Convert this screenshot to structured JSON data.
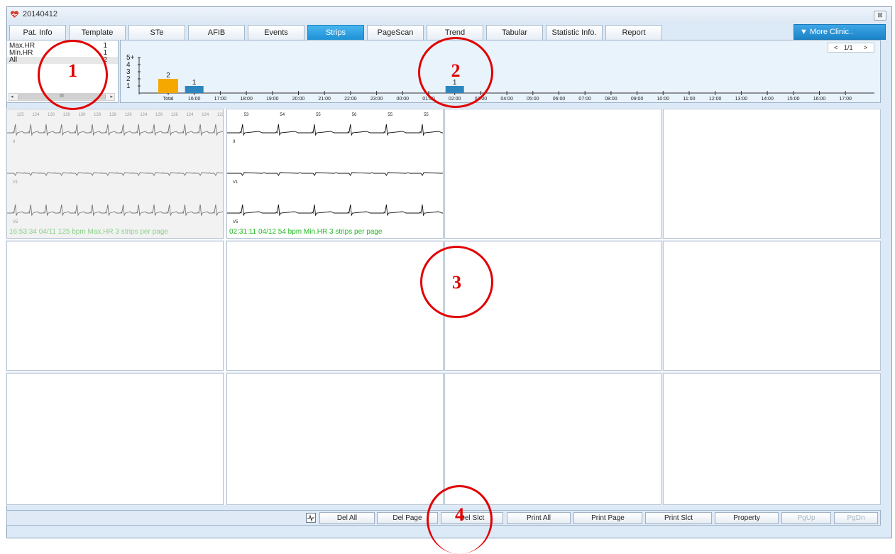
{
  "window": {
    "title": "20140412",
    "close_glyph": "⊠"
  },
  "tabs": [
    {
      "label": "Pat. Info"
    },
    {
      "label": "Template"
    },
    {
      "label": "STe"
    },
    {
      "label": "AFIB"
    },
    {
      "label": "Events"
    },
    {
      "label": "Strips",
      "active": true
    },
    {
      "label": "PageScan"
    },
    {
      "label": "Trend"
    },
    {
      "label": "Tabular"
    },
    {
      "label": "Statistic Info."
    },
    {
      "label": "Report"
    }
  ],
  "more_button": "▼ More Clinic..",
  "strip_list": {
    "items": [
      {
        "name": "Max.HR",
        "count": "1"
      },
      {
        "name": "Min.HR",
        "count": "1"
      },
      {
        "name": "All",
        "count": "2",
        "selected": true
      }
    ],
    "scroll_thumb": "III"
  },
  "hist_chart": {
    "pager": {
      "prev": "<",
      "page": "1/1",
      "next": ">"
    },
    "y_ticks": [
      "5+",
      "4",
      "3",
      "2",
      "1"
    ],
    "x_labels": [
      "Total",
      "16:00",
      "17:00",
      "18:00",
      "19:00",
      "20:00",
      "21:00",
      "22:00",
      "23:00",
      "00:00",
      "01:00",
      "02:00",
      "03:00",
      "04:00",
      "05:00",
      "06:00",
      "07:00",
      "08:00",
      "09:00",
      "10:00",
      "11:00",
      "12:00",
      "13:00",
      "14:00",
      "15:00",
      "16:00",
      "17:00"
    ],
    "bars": [
      {
        "x_index": 0,
        "value": 2,
        "label": "2",
        "color": "#f5a800"
      },
      {
        "x_index": 1,
        "value": 1,
        "label": "1",
        "color": "#2e86c1"
      },
      {
        "x_index": 11,
        "value": 1,
        "label": "1",
        "color": "#2e86c1"
      }
    ]
  },
  "strips": [
    {
      "caption": "16:53:34 04/11  125 bpm  Max.HR  3 strips per page",
      "beat_labels": [
        "125",
        "124",
        "126",
        "126",
        "130",
        "126",
        "128",
        "126",
        "124",
        "126",
        "126",
        "124",
        "124",
        "122"
      ],
      "leads": [
        "II",
        "V1",
        "V5"
      ],
      "selected": true
    },
    {
      "caption": "02:31:11 04/12  54 bpm  Min.HR  3 strips per page",
      "beat_labels": [
        "53",
        "54",
        "55",
        "56",
        "55",
        "55"
      ],
      "leads": [
        "II",
        "V1",
        "V5"
      ],
      "selected": false
    }
  ],
  "toolbar": {
    "buttons": [
      {
        "label": "Del All",
        "enabled": true
      },
      {
        "label": "Del Page",
        "enabled": true
      },
      {
        "label": "Del Slct",
        "enabled": true
      },
      {
        "label": "Print All",
        "enabled": true
      },
      {
        "label": "Print Page",
        "enabled": true
      },
      {
        "label": "Print Slct",
        "enabled": true
      },
      {
        "label": "Property",
        "enabled": true
      },
      {
        "label": "PgUp",
        "enabled": false
      },
      {
        "label": "PgDn",
        "enabled": false
      }
    ]
  },
  "annotations": [
    "1",
    "2",
    "3",
    "4"
  ],
  "colors": {
    "accent": "#1b8fd3",
    "annotation": "#e10000",
    "caption": "#22b822",
    "bar_total": "#f5a800",
    "bar_hour": "#2e86c1"
  }
}
